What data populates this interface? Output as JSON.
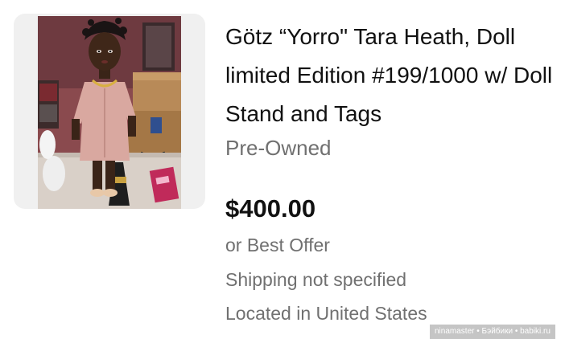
{
  "listing": {
    "title": "Götz “Yorro\" Tara Heath, Doll limited Edition #199/1000 w/ Doll Stand and Tags",
    "condition": "Pre-Owned",
    "price": "$400.00",
    "offer": "or Best Offer",
    "shipping": "Shipping not specified",
    "location": "Located in United States"
  },
  "watermark": "ninamaster • Бэйбики • babiki.ru",
  "photo": {
    "subject": "doll-photo"
  },
  "colors": {
    "title_text": "#111111",
    "secondary_text": "#707070",
    "card_background": "#f0f0f0"
  }
}
